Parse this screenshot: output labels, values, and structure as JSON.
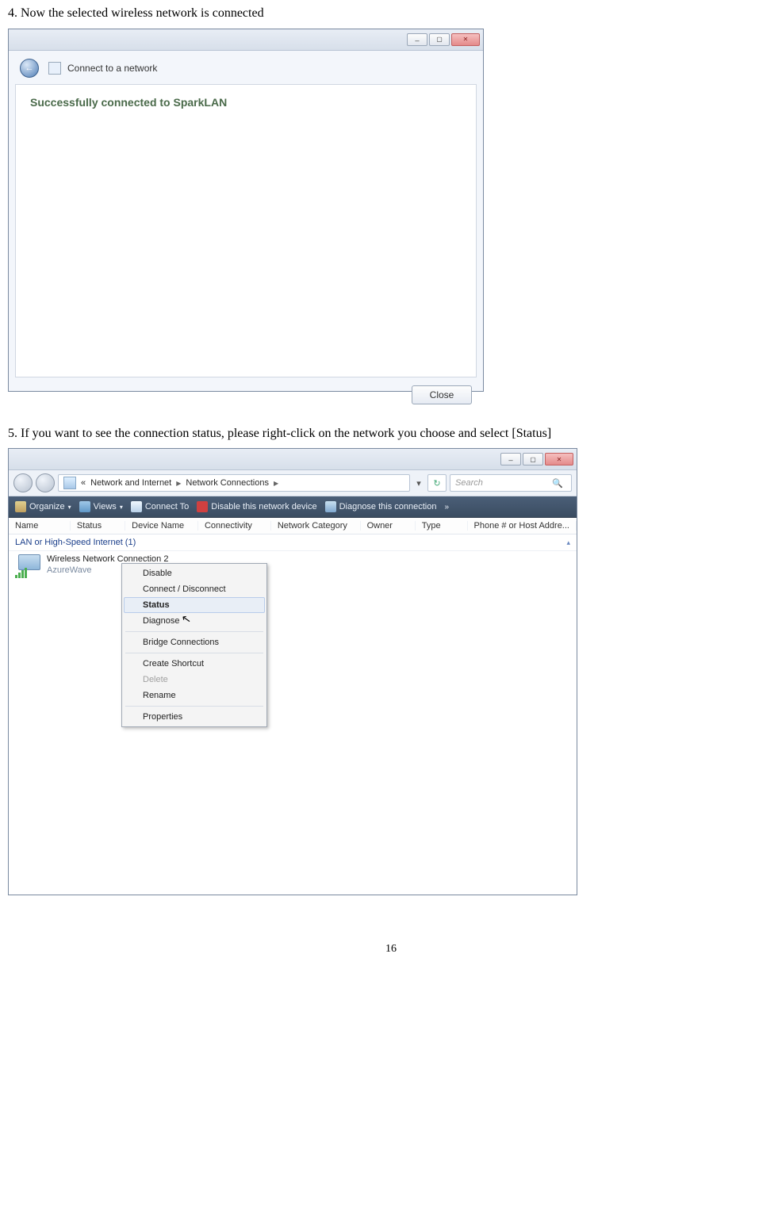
{
  "step4": {
    "text": "4. Now the selected wireless network is connected"
  },
  "dialog1": {
    "title": "Connect to a network",
    "success": "Successfully connected to SparkLAN",
    "close_btn": "Close"
  },
  "step5": {
    "text": "5. If you want to see the connection status, please right-click on the network you choose and select [Status]"
  },
  "explorer": {
    "breadcrumb": {
      "prefix": "«",
      "seg1": "Network and Internet",
      "seg2": "Network Connections"
    },
    "search_placeholder": "Search",
    "cmdbar": {
      "organize": "Organize",
      "views": "Views",
      "connect": "Connect To",
      "disable": "Disable this network device",
      "diagnose": "Diagnose this connection",
      "more": "»"
    },
    "columns": {
      "name": "Name",
      "status": "Status",
      "device": "Device Name",
      "connectivity": "Connectivity",
      "category": "Network Category",
      "owner": "Owner",
      "type": "Type",
      "phone": "Phone # or Host Addre..."
    },
    "group": "LAN or High-Speed Internet (1)",
    "connection": {
      "name": "Wireless Network Connection 2",
      "sub": "AzureWave"
    },
    "contextmenu": {
      "disable": "Disable",
      "connect": "Connect / Disconnect",
      "status": "Status",
      "diagnose": "Diagnose",
      "bridge": "Bridge Connections",
      "shortcut": "Create Shortcut",
      "delete": "Delete",
      "rename": "Rename",
      "properties": "Properties"
    }
  },
  "page_number": "16"
}
